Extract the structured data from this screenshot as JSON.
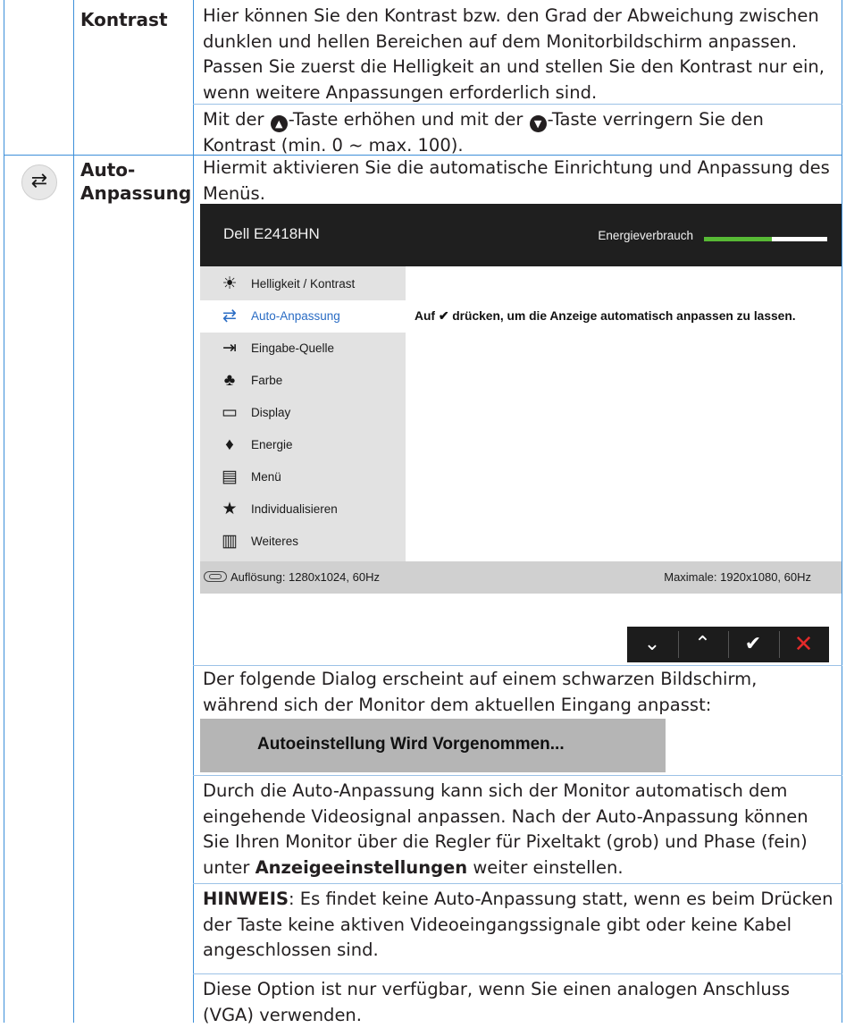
{
  "rows": [
    {
      "label": "Kontrast",
      "paragraphs": [
        "Hier können Sie den Kontrast bzw. den Grad der Abweichung zwischen dunklen und hellen Bereichen auf dem Monitorbildschirm anpassen. Passen Sie zuerst die Helligkeit an und stellen Sie den Kontrast nur ein, wenn weitere Anpassungen erforderlich sind."
      ],
      "buttons_sentence": {
        "prefix": "Mit der ",
        "mid": "-Taste erhöhen und mit der ",
        "suffix": "-Taste verringern Sie den Kontrast (min. 0 ~ max. 100)."
      }
    },
    {
      "label_line1": "Auto-",
      "label_line2": "Anpassung",
      "intro": "Hiermit aktivieren Sie die automatische Einrichtung und Anpassung des Menüs.",
      "dialog_text": "Der folgende Dialog erscheint auf einem schwarzen Bildschirm, während sich der Monitor dem aktuellen Eingang anpasst:",
      "autoset_label": "Autoeinstellung Wird Vorgenommen...",
      "para_auto": "Durch die Auto-Anpassung kann sich der Monitor automatisch dem eingehende Videosignal anpassen. Nach der Auto-Anpassung können Sie Ihren Monitor über die Regler für Pixeltakt (grob) und Phase (fein) unter ",
      "para_auto_bold": "Anzeigeeinstellungen",
      "para_auto_end": " weiter einstellen.",
      "note_label": "HINWEIS",
      "note_text": ": Es findet keine Auto-Anpassung statt, wenn es beim Drücken der Taste keine aktiven Videoeingangssignale gibt oder keine Kabel angeschlossen sind.",
      "vga_text": "Diese Option ist nur verfügbar, wenn Sie einen analogen Anschluss (VGA) verwenden."
    }
  ],
  "osd": {
    "title": "Dell E2418HN",
    "energy_label": "Energieverbrauch",
    "energy_level": 0.55,
    "energy_color": "#57b935",
    "menu_items": [
      {
        "label": "Helligkeit / Kontrast",
        "icon": "sun-icon",
        "glyph": "☀"
      },
      {
        "label": "Auto-Anpassung",
        "icon": "auto-adjust-icon",
        "glyph": "⇄",
        "active": true
      },
      {
        "label": "Eingabe-Quelle",
        "icon": "input-source-icon",
        "glyph": "⇥"
      },
      {
        "label": "Farbe",
        "icon": "color-icon",
        "glyph": "♣"
      },
      {
        "label": "Display",
        "icon": "display-icon",
        "glyph": "▭"
      },
      {
        "label": "Energie",
        "icon": "energy-icon",
        "glyph": "♦"
      },
      {
        "label": "Menü",
        "icon": "menu-icon",
        "glyph": "▤"
      },
      {
        "label": "Individualisieren",
        "icon": "star-icon",
        "glyph": "★"
      },
      {
        "label": "Weiteres",
        "icon": "others-icon",
        "glyph": "▥"
      }
    ],
    "message_pre": "Auf ",
    "message_post": " drücken, um die Anzeige automatisch anpassen zu lassen.",
    "resolution": "Auflösung: 1280x1024, 60Hz",
    "max_resolution": "Maximale: 1920x1080, 60Hz",
    "buttons": [
      {
        "icon": "chevron-down-icon",
        "glyph": "⌄"
      },
      {
        "icon": "chevron-up-icon",
        "glyph": "⌃"
      },
      {
        "icon": "check-icon",
        "glyph": "✔"
      },
      {
        "icon": "close-icon",
        "glyph": "✕"
      }
    ]
  }
}
